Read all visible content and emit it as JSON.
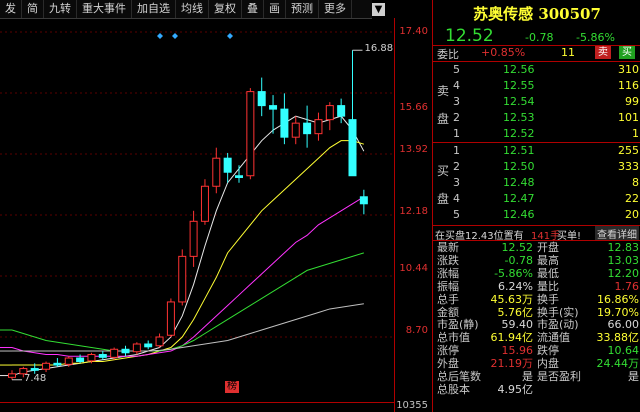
{
  "toolbar": {
    "buttons": [
      "发",
      "简",
      "九转",
      "重大事件",
      "加自选",
      "均线",
      "复权",
      "叠",
      "画",
      "预测",
      "更多"
    ],
    "download_icon": "down-arrow-icon"
  },
  "chart": {
    "y_labels": [
      "17.40",
      "15.66",
      "13.92",
      "12.18",
      "10.44",
      "8.70",
      "10355"
    ],
    "high_annotation": "16.88",
    "low_annotation": "7.48",
    "marker_label": "榜"
  },
  "chart_data": {
    "type": "candlestick",
    "yrange": [
      6.96,
      17.4
    ],
    "ticks": [
      17.4,
      15.66,
      13.92,
      12.18,
      10.44,
      8.7
    ],
    "candles": [
      {
        "o": 7.55,
        "h": 7.75,
        "l": 7.48,
        "c": 7.65
      },
      {
        "o": 7.65,
        "h": 7.85,
        "l": 7.55,
        "c": 7.8
      },
      {
        "o": 7.8,
        "h": 7.95,
        "l": 7.65,
        "c": 7.75
      },
      {
        "o": 7.78,
        "h": 8.0,
        "l": 7.7,
        "c": 7.95
      },
      {
        "o": 7.95,
        "h": 8.1,
        "l": 7.85,
        "c": 7.9
      },
      {
        "o": 7.92,
        "h": 8.15,
        "l": 7.85,
        "c": 8.1
      },
      {
        "o": 8.1,
        "h": 8.2,
        "l": 7.95,
        "c": 8.0
      },
      {
        "o": 8.02,
        "h": 8.25,
        "l": 7.95,
        "c": 8.2
      },
      {
        "o": 8.2,
        "h": 8.3,
        "l": 8.05,
        "c": 8.12
      },
      {
        "o": 8.12,
        "h": 8.4,
        "l": 8.05,
        "c": 8.35
      },
      {
        "o": 8.35,
        "h": 8.45,
        "l": 8.15,
        "c": 8.25
      },
      {
        "o": 8.28,
        "h": 8.55,
        "l": 8.2,
        "c": 8.5
      },
      {
        "o": 8.5,
        "h": 8.6,
        "l": 8.35,
        "c": 8.42
      },
      {
        "o": 8.45,
        "h": 8.8,
        "l": 8.4,
        "c": 8.7
      },
      {
        "o": 8.75,
        "h": 9.8,
        "l": 8.7,
        "c": 9.7
      },
      {
        "o": 9.7,
        "h": 11.2,
        "l": 9.6,
        "c": 11.0
      },
      {
        "o": 11.0,
        "h": 12.3,
        "l": 10.7,
        "c": 12.0
      },
      {
        "o": 12.0,
        "h": 13.2,
        "l": 11.9,
        "c": 13.0
      },
      {
        "o": 13.0,
        "h": 14.1,
        "l": 12.8,
        "c": 13.8
      },
      {
        "o": 13.8,
        "h": 13.95,
        "l": 13.1,
        "c": 13.4
      },
      {
        "o": 13.3,
        "h": 13.6,
        "l": 13.1,
        "c": 13.25
      },
      {
        "o": 13.3,
        "h": 15.8,
        "l": 13.2,
        "c": 15.7
      },
      {
        "o": 15.7,
        "h": 16.1,
        "l": 15.0,
        "c": 15.3
      },
      {
        "o": 15.3,
        "h": 15.6,
        "l": 14.5,
        "c": 15.2
      },
      {
        "o": 15.2,
        "h": 15.65,
        "l": 14.2,
        "c": 14.4
      },
      {
        "o": 14.4,
        "h": 15.0,
        "l": 14.2,
        "c": 14.8
      },
      {
        "o": 14.8,
        "h": 15.3,
        "l": 14.1,
        "c": 14.5
      },
      {
        "o": 14.5,
        "h": 15.1,
        "l": 14.3,
        "c": 14.9
      },
      {
        "o": 14.9,
        "h": 15.4,
        "l": 14.6,
        "c": 15.3
      },
      {
        "o": 15.3,
        "h": 15.5,
        "l": 14.8,
        "c": 15.0
      },
      {
        "o": 14.9,
        "h": 16.88,
        "l": 14.3,
        "c": 13.3
      },
      {
        "o": 12.7,
        "h": 12.9,
        "l": 12.2,
        "c": 12.5
      }
    ],
    "ma_lines": [
      {
        "name": "MA5",
        "color": "#e8e8e8",
        "values": [
          7.6,
          7.7,
          7.75,
          7.8,
          7.85,
          7.9,
          7.95,
          8.0,
          8.05,
          8.1,
          8.15,
          8.2,
          8.3,
          8.4,
          8.7,
          9.3,
          10.2,
          11.3,
          12.3,
          13.1,
          13.5,
          13.9,
          14.3,
          14.6,
          14.8,
          15.0,
          14.9,
          14.8,
          14.9,
          15.0,
          14.6,
          14.0
        ]
      },
      {
        "name": "MA10",
        "color": "#ffff33",
        "values": [
          7.9,
          7.9,
          7.9,
          7.9,
          7.9,
          7.95,
          7.95,
          8.0,
          8.0,
          8.05,
          8.1,
          8.15,
          8.2,
          8.3,
          8.4,
          8.7,
          9.2,
          9.8,
          10.4,
          11.1,
          11.5,
          11.9,
          12.3,
          12.6,
          12.9,
          13.2,
          13.5,
          13.8,
          14.1,
          14.3,
          14.3,
          14.2
        ]
      },
      {
        "name": "MA20",
        "color": "#ff33ff",
        "values": [
          8.4,
          8.3,
          8.25,
          8.2,
          8.2,
          8.15,
          8.15,
          8.15,
          8.15,
          8.15,
          8.15,
          8.15,
          8.2,
          8.25,
          8.3,
          8.45,
          8.7,
          9.0,
          9.3,
          9.6,
          9.9,
          10.2,
          10.5,
          10.8,
          11.1,
          11.4,
          11.6,
          11.9,
          12.1,
          12.3,
          12.5,
          12.7
        ]
      },
      {
        "name": "MA30",
        "color": "#33dd33",
        "values": [
          8.9,
          8.8,
          8.7,
          8.6,
          8.55,
          8.5,
          8.45,
          8.4,
          8.35,
          8.3,
          8.3,
          8.3,
          8.3,
          8.3,
          8.35,
          8.45,
          8.6,
          8.8,
          9.0,
          9.2,
          9.4,
          9.6,
          9.8,
          10.0,
          10.2,
          10.4,
          10.6,
          10.7,
          10.8,
          10.9,
          11.0,
          11.1
        ]
      },
      {
        "name": "MA60",
        "color": "#c0c0c0",
        "values": [
          8.3,
          8.3,
          8.3,
          8.3,
          8.3,
          8.3,
          8.3,
          8.3,
          8.3,
          8.3,
          8.3,
          8.3,
          8.3,
          8.32,
          8.35,
          8.4,
          8.45,
          8.5,
          8.55,
          8.6,
          8.7,
          8.8,
          8.9,
          9.0,
          9.1,
          9.2,
          9.3,
          9.4,
          9.5,
          9.55,
          9.6,
          9.65
        ]
      }
    ],
    "markers": [
      {
        "index": 0
      },
      {
        "index": 1
      },
      {
        "index": 6
      }
    ]
  },
  "stock": {
    "name": "苏奥传感",
    "code": "300507",
    "price": "12.52",
    "change": "-0.78",
    "change_pct": "-5.86%"
  },
  "order_book": {
    "wb_label": "委比",
    "wb_value": "+0.85%",
    "wc_value": "11",
    "sell_btn": "卖",
    "buy_btn": "买",
    "sell_side_label": "卖盘",
    "buy_side_label": "买盘",
    "asks": [
      {
        "idx": "5",
        "price": "12.56",
        "vol": "310"
      },
      {
        "idx": "4",
        "price": "12.55",
        "vol": "116"
      },
      {
        "idx": "3",
        "price": "12.54",
        "vol": "99"
      },
      {
        "idx": "2",
        "price": "12.53",
        "vol": "101"
      },
      {
        "idx": "1",
        "price": "12.52",
        "vol": "1"
      }
    ],
    "bids": [
      {
        "idx": "1",
        "price": "12.51",
        "vol": "255"
      },
      {
        "idx": "2",
        "price": "12.50",
        "vol": "333"
      },
      {
        "idx": "3",
        "price": "12.48",
        "vol": "8"
      },
      {
        "idx": "4",
        "price": "12.47",
        "vol": "22"
      },
      {
        "idx": "5",
        "price": "12.46",
        "vol": "20"
      }
    ],
    "summary_a": "在买盘12.43位置有",
    "summary_b": "141手",
    "summary_c": "买单!",
    "detail_btn": "查看详细"
  },
  "quote": [
    {
      "l": "最新",
      "v": "12.52",
      "vc": "green",
      "l2": "开盘",
      "v2": "12.83",
      "v2c": "green"
    },
    {
      "l": "涨跌",
      "v": "-0.78",
      "vc": "green",
      "l2": "最高",
      "v2": "13.03",
      "v2c": "green"
    },
    {
      "l": "涨幅",
      "v": "-5.86%",
      "vc": "green",
      "l2": "最低",
      "v2": "12.20",
      "v2c": "green"
    },
    {
      "l": "振幅",
      "v": "6.24%",
      "vc": "white",
      "l2": "量比",
      "v2": "1.76",
      "v2c": "red"
    },
    {
      "l": "总手",
      "v": "45.63万",
      "vc": "yellow",
      "l2": "换手",
      "v2": "16.86%",
      "v2c": "yellow"
    },
    {
      "l": "金额",
      "v": "5.76亿",
      "vc": "yellow",
      "l2": "换手(实)",
      "v2": "19.70%",
      "v2c": "yellow"
    },
    {
      "l": "市盈(静)",
      "v": "59.40",
      "vc": "white",
      "l2": "市盈(动)",
      "v2": "66.00",
      "v2c": "white"
    },
    {
      "l": "总市值",
      "v": "61.94亿",
      "vc": "yellow",
      "l2": "流通值",
      "v2": "33.88亿",
      "v2c": "yellow"
    },
    {
      "l": "涨停",
      "v": "15.96",
      "vc": "red",
      "l2": "跌停",
      "v2": "10.64",
      "v2c": "green"
    },
    {
      "l": "外盘",
      "v": "21.19万",
      "vc": "red",
      "l2": "内盘",
      "v2": "24.44万",
      "v2c": "green"
    },
    {
      "l": "总后笔数",
      "v": "是",
      "vc": "white",
      "l2": "是否盈利",
      "v2": "是",
      "v2c": "white"
    },
    {
      "l": "总股本",
      "v": "4.95亿",
      "vc": "white",
      "l2": "",
      "v2": "",
      "v2c": "white"
    }
  ]
}
